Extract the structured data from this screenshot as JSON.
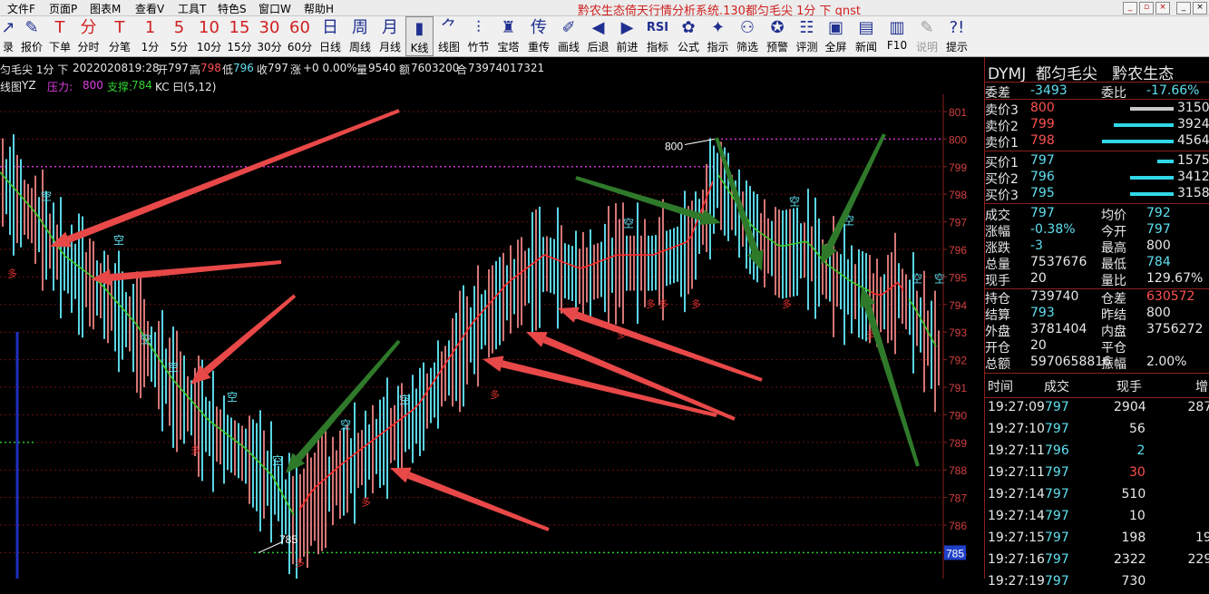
{
  "menu": [
    "文件F",
    "页面P",
    "图表M",
    "查看V",
    "工具T",
    "特色S",
    "窗口W",
    "帮助H"
  ],
  "window_title": "黔农生态倚天行情分析系统.130都匀毛尖 1分 下 qnst",
  "toolbar": [
    {
      "icon": "↗",
      "label": "录",
      "icon_name": "login-icon"
    },
    {
      "icon": "✎",
      "label": "报价",
      "icon_name": "quote-icon"
    },
    {
      "icon": "T",
      "label": "下单",
      "icon_name": "order-icon"
    },
    {
      "icon": "分",
      "label": "分时",
      "icon_name": "timeshare-icon"
    },
    {
      "icon": "T",
      "label": "分笔",
      "icon_name": "tick-icon"
    },
    {
      "icon": "1",
      "label": "1分",
      "icon_name": "period-1min-icon"
    },
    {
      "icon": "5",
      "label": "5分",
      "icon_name": "period-5min-icon"
    },
    {
      "icon": "10",
      "label": "10分",
      "icon_name": "period-10min-icon"
    },
    {
      "icon": "15",
      "label": "15分",
      "icon_name": "period-15min-icon"
    },
    {
      "icon": "30",
      "label": "30分",
      "icon_name": "period-30min-icon"
    },
    {
      "icon": "60",
      "label": "60分",
      "icon_name": "period-60min-icon"
    },
    {
      "icon": "日",
      "label": "日线",
      "icon_name": "daily-icon"
    },
    {
      "icon": "周",
      "label": "周线",
      "icon_name": "weekly-icon"
    },
    {
      "icon": "月",
      "label": "月线",
      "icon_name": "monthly-icon"
    },
    {
      "icon": "▮",
      "label": "K线",
      "icon_name": "kline-icon"
    },
    {
      "icon": "⺈",
      "label": "线图",
      "icon_name": "linechart-icon"
    },
    {
      "icon": "⫶",
      "label": "竹节",
      "icon_name": "bamboo-icon"
    },
    {
      "icon": "♜",
      "label": "宝塔",
      "icon_name": "tower-icon"
    },
    {
      "icon": "传",
      "label": "重传",
      "icon_name": "resend-icon"
    },
    {
      "icon": "✐",
      "label": "画线",
      "icon_name": "draw-icon"
    },
    {
      "icon": "◀",
      "label": "后退",
      "icon_name": "back-icon"
    },
    {
      "icon": "▶",
      "label": "前进",
      "icon_name": "forward-icon"
    },
    {
      "icon": "RSI",
      "label": "指标",
      "icon_name": "indicator-icon"
    },
    {
      "icon": "✿",
      "label": "公式",
      "icon_name": "formula-icon"
    },
    {
      "icon": "✦",
      "label": "指示",
      "icon_name": "signal-icon"
    },
    {
      "icon": "⚇",
      "label": "筛选",
      "icon_name": "filter-icon"
    },
    {
      "icon": "✪",
      "label": "预警",
      "icon_name": "alert-icon"
    },
    {
      "icon": "☷",
      "label": "评测",
      "icon_name": "test-icon"
    },
    {
      "icon": "▣",
      "label": "全屏",
      "icon_name": "fullscreen-icon"
    },
    {
      "icon": "▤",
      "label": "新闻",
      "icon_name": "news-icon"
    },
    {
      "icon": "▥",
      "label": "F10",
      "icon_name": "f10-icon"
    },
    {
      "icon": "✎",
      "label": "说明",
      "icon_name": "help-doc-icon"
    },
    {
      "icon": "?!",
      "label": "提示",
      "icon_name": "hint-icon"
    }
  ],
  "info": {
    "symbol": "匀毛尖 1分 下",
    "date": "20220208",
    "time": "19:28",
    "open_lbl": "开",
    "open": "797",
    "high_lbl": "高",
    "high": "798",
    "low_lbl": "低",
    "low": "796",
    "close_lbl": "收",
    "close": "797",
    "chg_lbl": "涨",
    "chg": "+0 0.00%",
    "vol_lbl": "量",
    "vol": "9540",
    "amt_lbl": "额",
    "amt": "7603200",
    "oi_lbl": "合",
    "oi": "739740",
    "extra": "17321"
  },
  "indicator": {
    "name": "线图",
    "yz": "YZ",
    "pressure_lbl": "压力:",
    "pressure": "800",
    "support_lbl": "支撑:",
    "support": "784",
    "kc": "KC 曰(5,12)"
  },
  "chart": {
    "y_labels": [
      "801",
      "800",
      "799",
      "798",
      "797",
      "796",
      "795",
      "794",
      "793",
      "792",
      "791",
      "790",
      "789",
      "788",
      "787",
      "786",
      "785"
    ],
    "high_mark": "800",
    "low_mark": "785",
    "current_price": "785",
    "kong_label": "空",
    "duo_label": "多",
    "colors": {
      "up": "#e07b7b",
      "down": "#5fe0f0",
      "ma_up": "#ff2a2a",
      "ma_down": "#3ec82a",
      "resist": "#d030d0",
      "support": "#2ac82a",
      "grid": "#6a1010",
      "axis": "#8a2020",
      "arrow_red": "#e84848",
      "arrow_green": "#2f7a2a"
    }
  },
  "quote": {
    "code": "DYMJ",
    "name": "都匀毛尖",
    "exchange": "黔农生态",
    "weicha_lbl": "委差",
    "weicha": "-3493",
    "weibi_lbl": "委比",
    "weibi": "-17.66%",
    "asks": [
      {
        "lbl": "卖价3",
        "price": "800",
        "qty": "3150",
        "bar": 0.55
      },
      {
        "lbl": "卖价2",
        "price": "799",
        "qty": "3924",
        "bar": 0.75
      },
      {
        "lbl": "卖价1",
        "price": "798",
        "qty": "4564",
        "bar": 0.9
      }
    ],
    "bids": [
      {
        "lbl": "买价1",
        "price": "797",
        "qty": "1575",
        "bar": 0.2
      },
      {
        "lbl": "买价2",
        "price": "796",
        "qty": "3412",
        "bar": 0.55
      },
      {
        "lbl": "买价3",
        "price": "795",
        "qty": "3158",
        "bar": 0.55
      }
    ],
    "stats": [
      [
        "成交",
        "797",
        "均价",
        "792"
      ],
      [
        "涨幅",
        "-0.38%",
        "今开",
        "797"
      ],
      [
        "涨跌",
        "-3",
        "最高",
        "800"
      ],
      [
        "总量",
        "7537676",
        "最低",
        "784"
      ],
      [
        "现手",
        "20",
        "量比",
        "129.67%"
      ],
      [
        "持仓",
        "739740",
        "仓差",
        "630572"
      ],
      [
        "结算",
        "793",
        "昨结",
        "800"
      ],
      [
        "外盘",
        "3781404",
        "内盘",
        "3756272"
      ],
      [
        "开仓",
        "20",
        "平仓",
        ""
      ],
      [
        "总额",
        "5970658816",
        "振幅",
        "2.00%"
      ]
    ],
    "trades_header": [
      "时间",
      "成交",
      "现手",
      "增"
    ],
    "trades": [
      [
        "19:27:09",
        "797",
        "2904",
        "287"
      ],
      [
        "19:27:10",
        "797",
        "56",
        ""
      ],
      [
        "19:27:11",
        "796",
        "2",
        ""
      ],
      [
        "19:27:11",
        "797",
        "30",
        ""
      ],
      [
        "19:27:14",
        "797",
        "510",
        ""
      ],
      [
        "19:27:14",
        "797",
        "10",
        ""
      ],
      [
        "19:27:15",
        "797",
        "198",
        "19"
      ],
      [
        "19:27:16",
        "797",
        "2322",
        "229"
      ],
      [
        "19:27:19",
        "797",
        "730",
        ""
      ]
    ]
  }
}
